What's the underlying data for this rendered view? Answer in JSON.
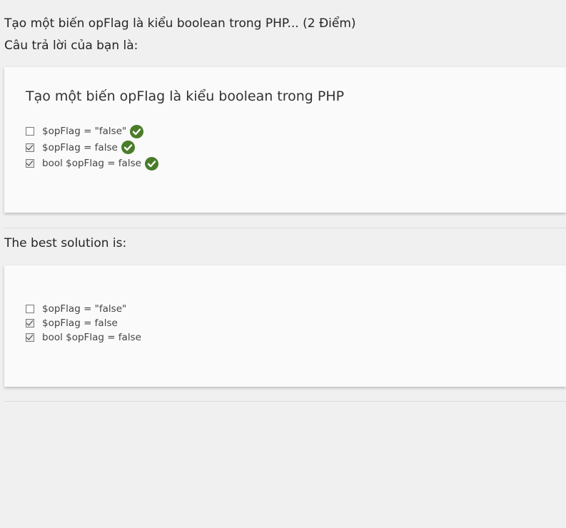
{
  "question": {
    "header": "Tạo một biến opFlag là kiểu boolean trong PHP... (2 Điểm)",
    "your_answer_label": "Câu trả lời của bạn là:"
  },
  "answer_card": {
    "title": "Tạo một biến opFlag là kiểu boolean trong PHP",
    "options": [
      {
        "label": "$opFlag = \"false\"",
        "checked": false,
        "icon": "green-check-icon"
      },
      {
        "label": "$opFlag = false",
        "checked": true,
        "icon": "green-check-icon"
      },
      {
        "label": "bool $opFlag = false",
        "checked": true,
        "icon": "green-check-icon"
      }
    ]
  },
  "solution": {
    "label": "The best solution is:",
    "options": [
      {
        "label": "$opFlag = \"false\"",
        "checked": false
      },
      {
        "label": "$opFlag = false",
        "checked": true
      },
      {
        "label": "bool $opFlag = false",
        "checked": true
      }
    ]
  },
  "colors": {
    "background": "#f0f0f0",
    "card": "#fafafa",
    "check_green": "#4a7c2a"
  }
}
